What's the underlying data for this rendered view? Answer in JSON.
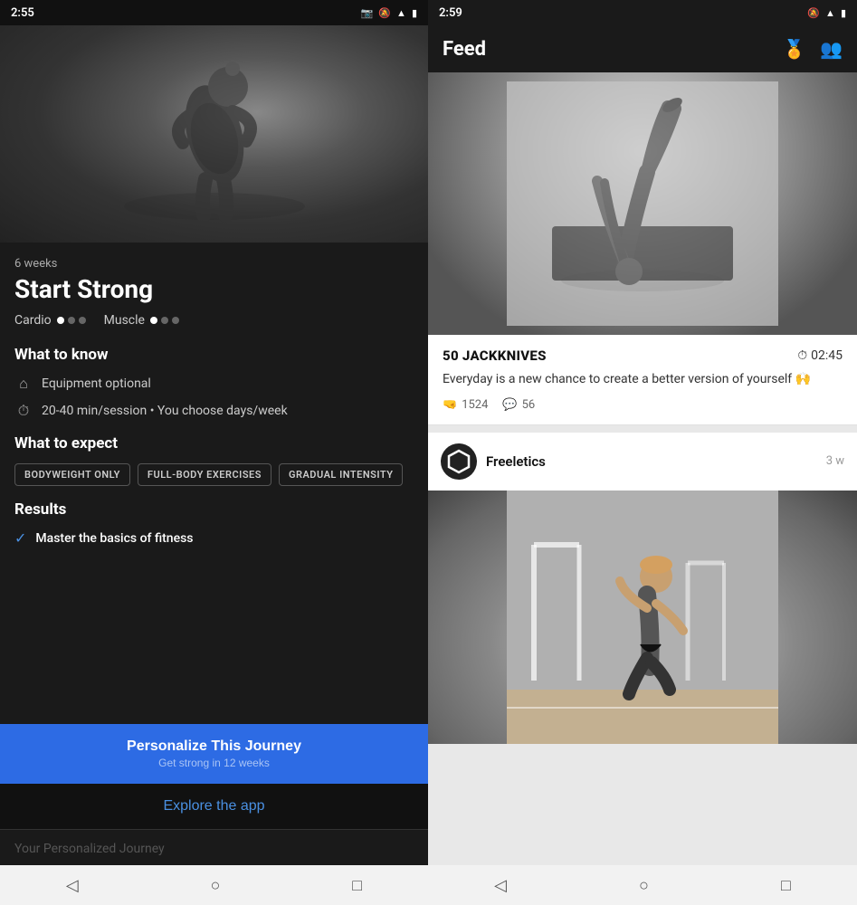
{
  "left": {
    "statusBar": {
      "time": "2:55",
      "icons": [
        "📷",
        "🔕",
        "📶",
        "🔋"
      ]
    },
    "hero": {
      "alt": "Man stretching arms fitness pose"
    },
    "duration": "6 weeks",
    "programTitle": "Start Strong",
    "intensity": {
      "cardioLabel": "Cardio",
      "cardioDots": [
        true,
        false,
        false
      ],
      "muscleLabel": "Muscle",
      "muscleDots": [
        true,
        false,
        false
      ]
    },
    "whatToKnow": {
      "sectionTitle": "What to know",
      "items": [
        {
          "icon": "🏠",
          "text": "Equipment optional"
        },
        {
          "icon": "⏱",
          "text": "20-40 min/session • You choose days/week"
        }
      ]
    },
    "whatToExpect": {
      "sectionTitle": "What to expect",
      "tags": [
        "BODYWEIGHT ONLY",
        "FULL-BODY EXERCISES",
        "GRADUAL INTENSITY"
      ]
    },
    "results": {
      "sectionTitle": "Results",
      "items": [
        {
          "text": "Master the basics of fitness"
        }
      ]
    },
    "btnPersonalize": {
      "mainLabel": "Personalize This Journey",
      "subLabel": "Get strong in 12 weeks"
    },
    "btnExplore": {
      "label": "Explore the app"
    },
    "personalizedJourney": {
      "text": "Your Personalized Journey"
    },
    "navBar": {
      "icons": [
        "◁",
        "○",
        "□"
      ]
    }
  },
  "right": {
    "statusBar": {
      "time": "2:59",
      "icons": [
        "🔕",
        "📶",
        "🔋"
      ]
    },
    "feedTitle": "Feed",
    "headerIcons": [
      "trophy",
      "people"
    ],
    "workoutCard": {
      "name": "50 JACKKNIVES",
      "time": "02:45",
      "caption": "Everyday is a new chance to create a better version of yourself 🙌",
      "likes": "1524",
      "comments": "56"
    },
    "post": {
      "username": "Freeletics",
      "timeAgo": "3 w",
      "alt": "Athlete sprinting on track"
    },
    "navBar": {
      "icons": [
        "◁",
        "○",
        "□"
      ]
    }
  }
}
